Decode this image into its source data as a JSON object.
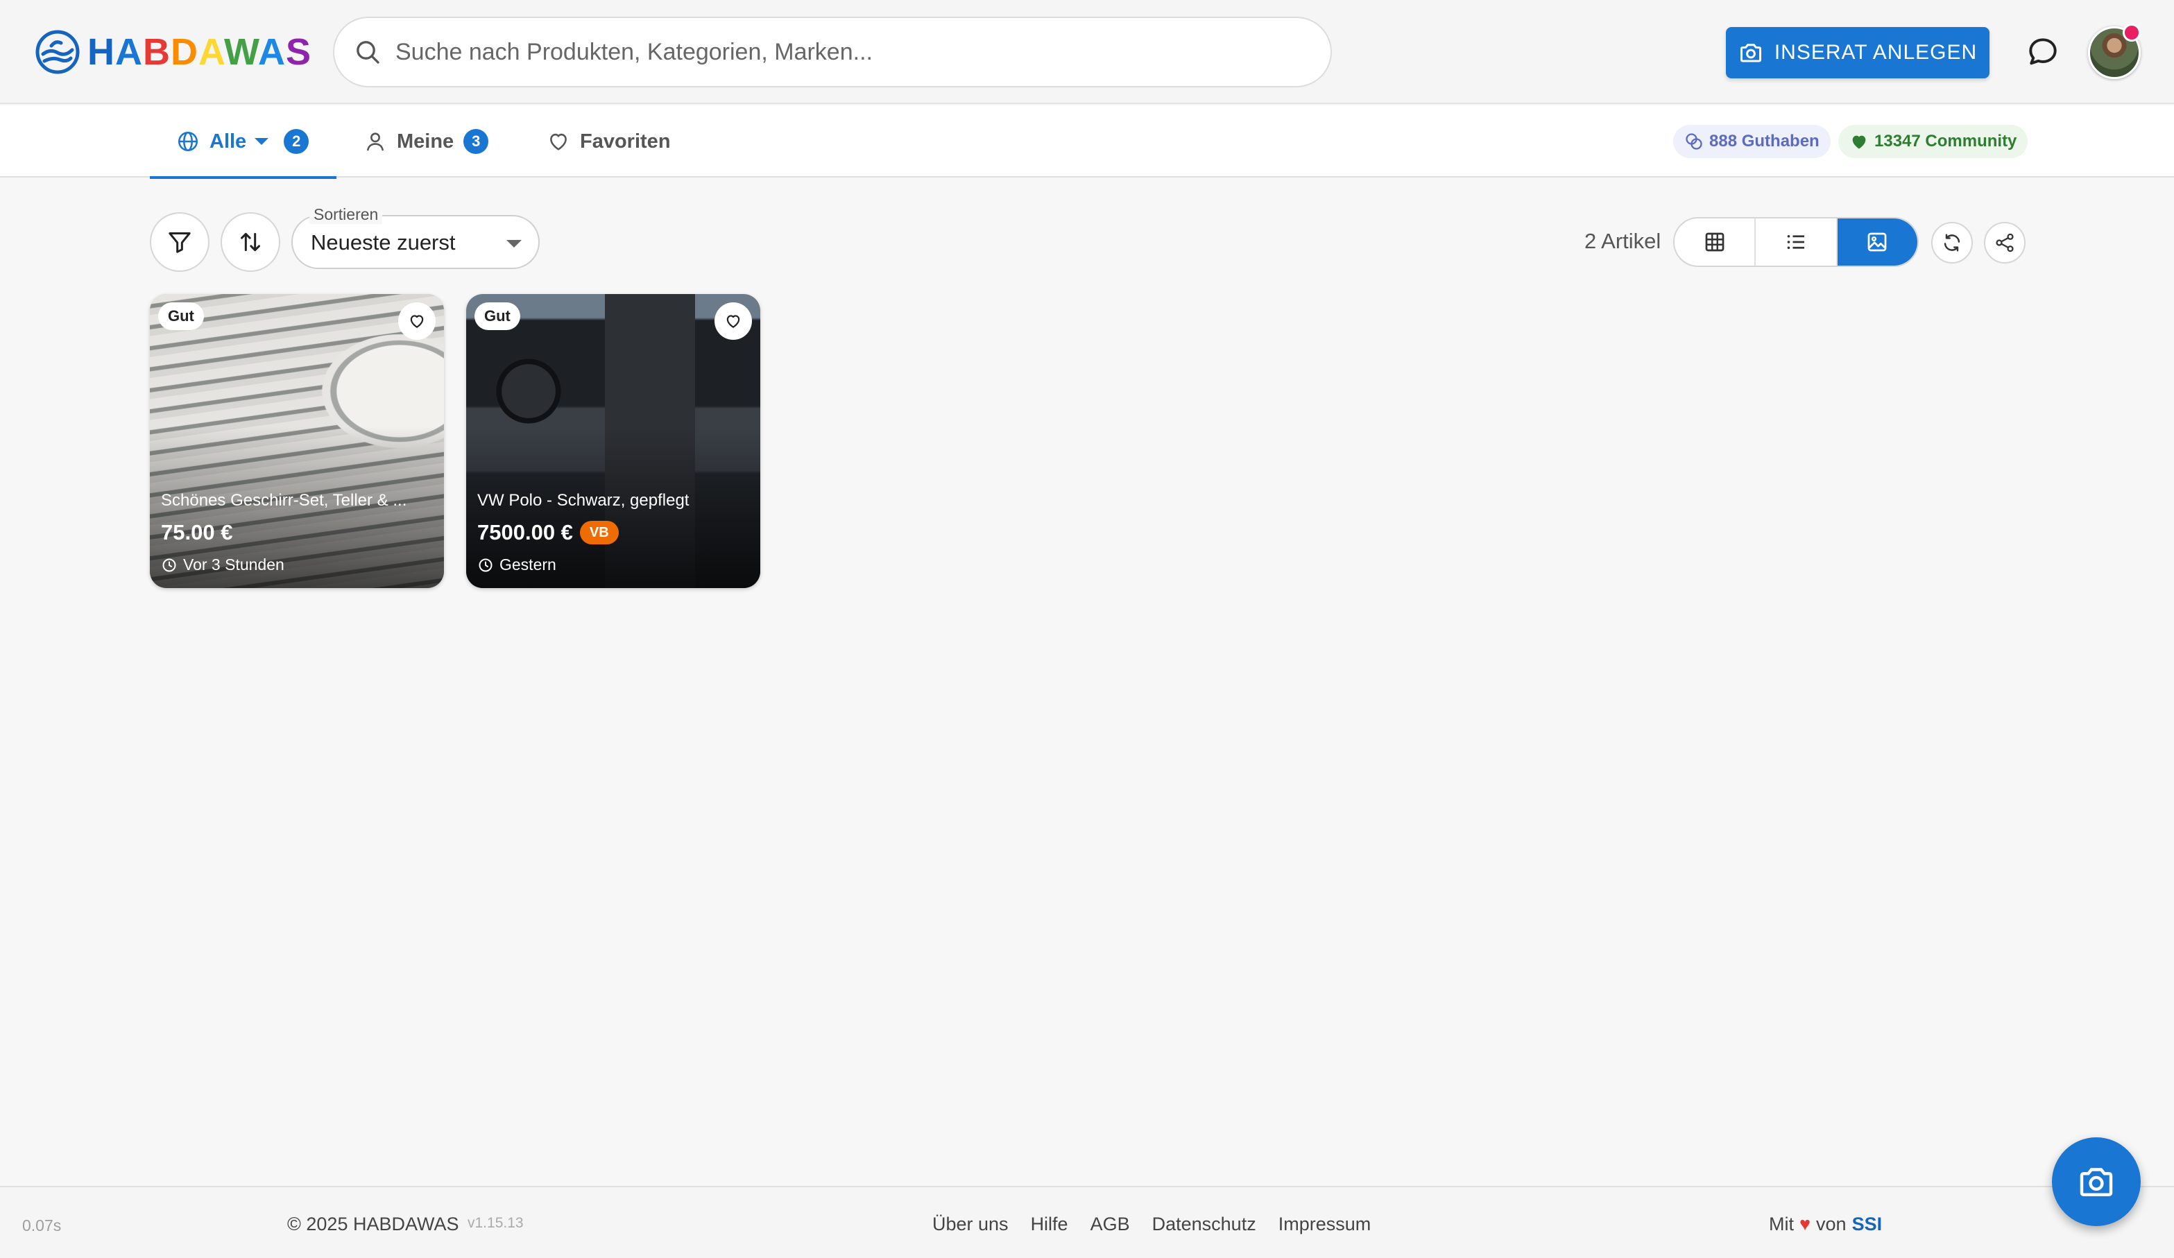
{
  "brand": {
    "name_letters": [
      "H",
      "A",
      "B",
      "D",
      "A",
      "W",
      "A",
      "S"
    ]
  },
  "search": {
    "placeholder": "Suche nach Produkten, Kategorien, Marken..."
  },
  "header": {
    "create_button_label": "INSERAT ANLEGEN",
    "accent_color": "#1976d2"
  },
  "tabs": [
    {
      "label": "Alle",
      "badge": "2",
      "active": true
    },
    {
      "label": "Meine",
      "badge": "3",
      "active": false
    },
    {
      "label": "Favoriten",
      "active": false
    }
  ],
  "chips": {
    "credit": "888 Guthaben",
    "community": "13347 Community"
  },
  "toolbar": {
    "sort_label": "Sortieren",
    "sort_value": "Neueste zuerst",
    "count": "2 Artikel",
    "view_modes": [
      "grid",
      "list",
      "gallery"
    ],
    "active_view": "gallery"
  },
  "listings": [
    {
      "condition": "Gut",
      "title": "Schönes Geschirr-Set, Teller & ...",
      "price": "75.00 €",
      "negotiable": "",
      "time": "Vor 3 Stunden"
    },
    {
      "condition": "Gut",
      "title": "VW Polo - Schwarz, gepflegt",
      "price": "7500.00 €",
      "negotiable": "VB",
      "time": "Gestern"
    }
  ],
  "footer": {
    "timing": "0.07s",
    "copyright": "© 2025 HABDAWAS",
    "version": "v1.15.13",
    "links": [
      "Über uns",
      "Hilfe",
      "AGB",
      "Datenschutz",
      "Impressum"
    ],
    "made_prefix": "Mit",
    "made_middle": "von",
    "made_by": "SSI"
  }
}
